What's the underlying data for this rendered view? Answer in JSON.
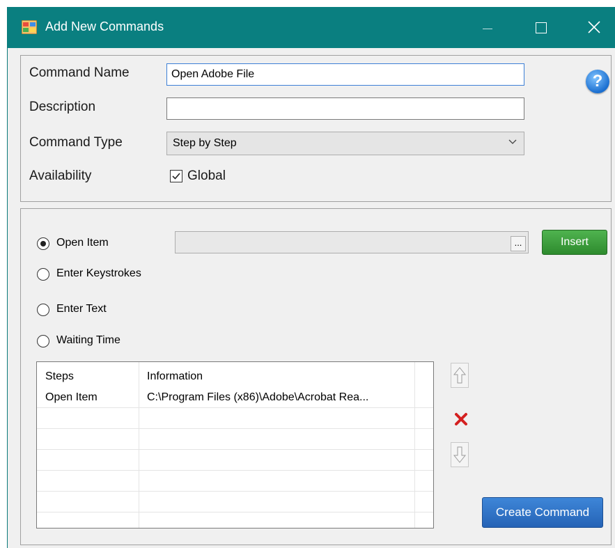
{
  "window": {
    "title": "Add New Commands"
  },
  "form": {
    "command_name_label": "Command Name",
    "command_name_value": "Open Adobe File",
    "description_label": "Description",
    "description_value": "",
    "command_type_label": "Command Type",
    "command_type_value": "Step by Step",
    "availability_label": "Availability",
    "global_label": "Global",
    "global_checked": true
  },
  "step_options": [
    {
      "label": "Open Item",
      "selected": true
    },
    {
      "label": "Enter Keystrokes",
      "selected": false
    },
    {
      "label": "Enter Text",
      "selected": false
    },
    {
      "label": "Waiting Time",
      "selected": false
    }
  ],
  "item_path": {
    "value": "",
    "browse_label": "...",
    "insert_label": "Insert"
  },
  "steps_table": {
    "headers": [
      "Steps",
      "Information"
    ],
    "rows": [
      [
        "Open Item",
        "C:\\Program Files (x86)\\Adobe\\Acrobat Rea..."
      ]
    ]
  },
  "buttons": {
    "create_label": "Create Command"
  },
  "icons": {
    "app": "app-window-icon",
    "help": "help-icon",
    "move_up": "arrow-up-icon",
    "delete": "delete-x-icon",
    "move_down": "arrow-down-icon"
  },
  "colors": {
    "titlebar": "#0a7f80",
    "insert_button": "#3a9e3a",
    "create_button": "#2f6fc4",
    "delete_icon": "#d42020"
  }
}
